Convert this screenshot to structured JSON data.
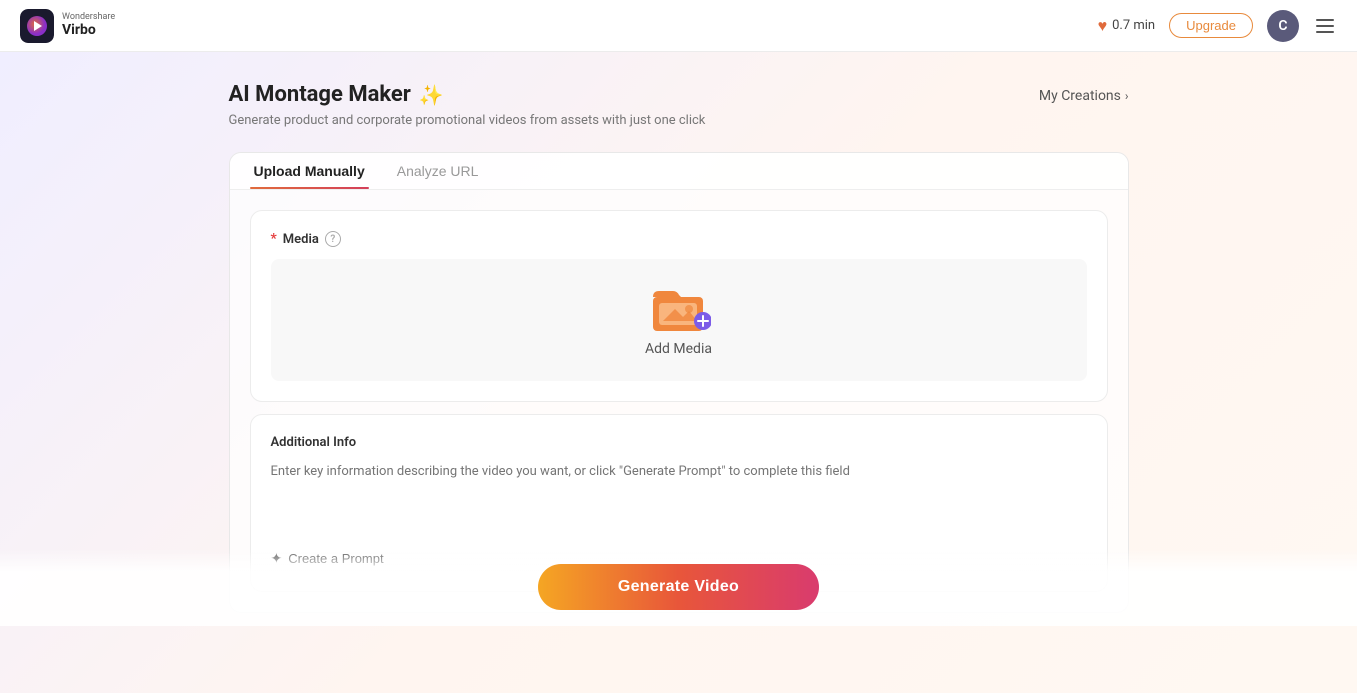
{
  "header": {
    "brand_wondershare": "Wondershare",
    "brand_virbo": "Virbo",
    "minutes": "0.7 min",
    "upgrade_label": "Upgrade",
    "avatar_letter": "C"
  },
  "page": {
    "title": "AI Montage Maker",
    "wand_emoji": "✨",
    "subtitle": "Generate product and corporate promotional videos from assets with just one click",
    "my_creations_label": "My Creations"
  },
  "tabs": [
    {
      "id": "upload",
      "label": "Upload Manually",
      "active": true
    },
    {
      "id": "url",
      "label": "Analyze URL",
      "active": false
    }
  ],
  "media_section": {
    "label": "Media",
    "add_media_label": "Add Media"
  },
  "additional_info": {
    "label": "Additional Info",
    "placeholder": "Enter key information describing the video you want, or click \"Generate Prompt\" to complete this field",
    "create_prompt_label": "Create a Prompt"
  },
  "generate_btn": {
    "label": "Generate Video"
  }
}
